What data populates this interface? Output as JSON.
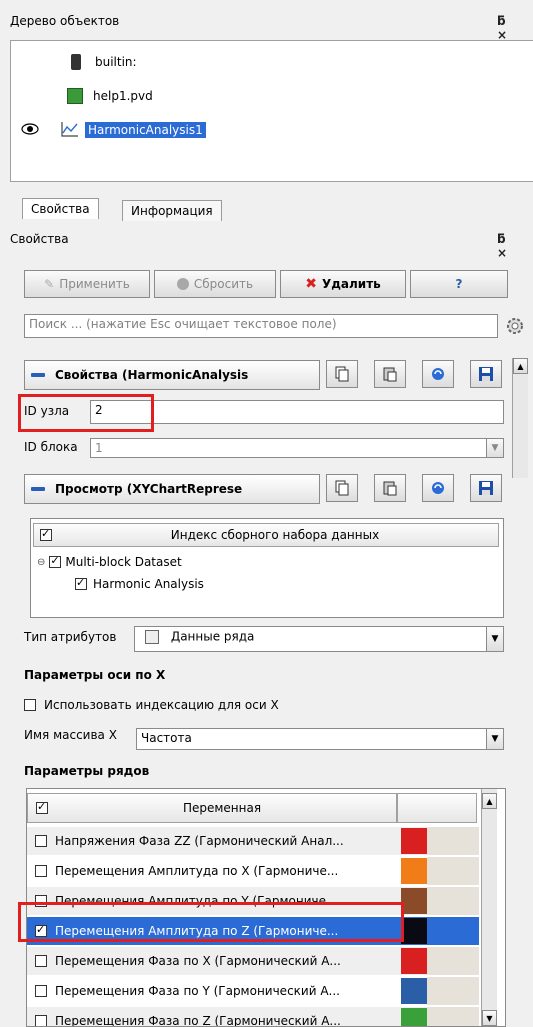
{
  "object_tree": {
    "title": "Дерево объектов",
    "dock_buttons": "Ʒ ×",
    "items": [
      {
        "label": "builtin:"
      },
      {
        "label": "help1.pvd"
      },
      {
        "label": "HarmonicAnalysis1"
      }
    ]
  },
  "tabs": [
    {
      "label": "Свойства"
    },
    {
      "label": "Информация"
    }
  ],
  "properties_panel": {
    "title": "Свойства",
    "buttons": {
      "apply": "Применить",
      "reset": "Сбросить",
      "delete": "Удалить",
      "help": "?"
    },
    "search_placeholder": "Поиск ... (нажатие Esc очищает текстовое поле)",
    "section_properties": "Свойства (HarmonicAnalysis",
    "node_id_label": "ID узла",
    "node_id_value": "2",
    "block_id_label": "ID блока",
    "block_id_value": "1",
    "section_view": "Просмотр (XYChartReprese",
    "composite_header": "Индекс сборного набора данных",
    "composite_tree": [
      {
        "label": "Multi-block Dataset"
      },
      {
        "label": "Harmonic Analysis"
      }
    ],
    "attr_type_label": "Тип атрибутов",
    "attr_type_value": "Данные ряда",
    "x_axis_header": "Параметры оси по X",
    "use_index_label": "Использовать индексацию для оси X",
    "x_array_label": "Имя массива X",
    "x_array_value": "Частота",
    "series_header": "Параметры рядов",
    "series_column": "Переменная",
    "series": [
      {
        "label": "Напряжения Фаза ZZ (Гармонический Анал...",
        "checked": false,
        "color": "#d82020"
      },
      {
        "label": "Перемещения Амплитуда по X (Гармониче...",
        "checked": false,
        "color": "#f07d18"
      },
      {
        "label": "Перемещения Амплитуда по Y (Гармониче...",
        "checked": false,
        "color": "#8b4a28"
      },
      {
        "label": "Перемещения Амплитуда по Z (Гармониче...",
        "checked": true,
        "color": "#0a0a14"
      },
      {
        "label": "Перемещения Фаза по X (Гармонический А...",
        "checked": false,
        "color": "#d82020"
      },
      {
        "label": "Перемещения Фаза по Y (Гармонический А...",
        "checked": false,
        "color": "#2a5fa8"
      },
      {
        "label": "Перемещения Фаза по Z (Гармонический А...",
        "checked": false,
        "color": "#3aa03a"
      }
    ]
  },
  "colors": {
    "selection": "#2a6bd6",
    "highlight_box": "#e02020"
  }
}
